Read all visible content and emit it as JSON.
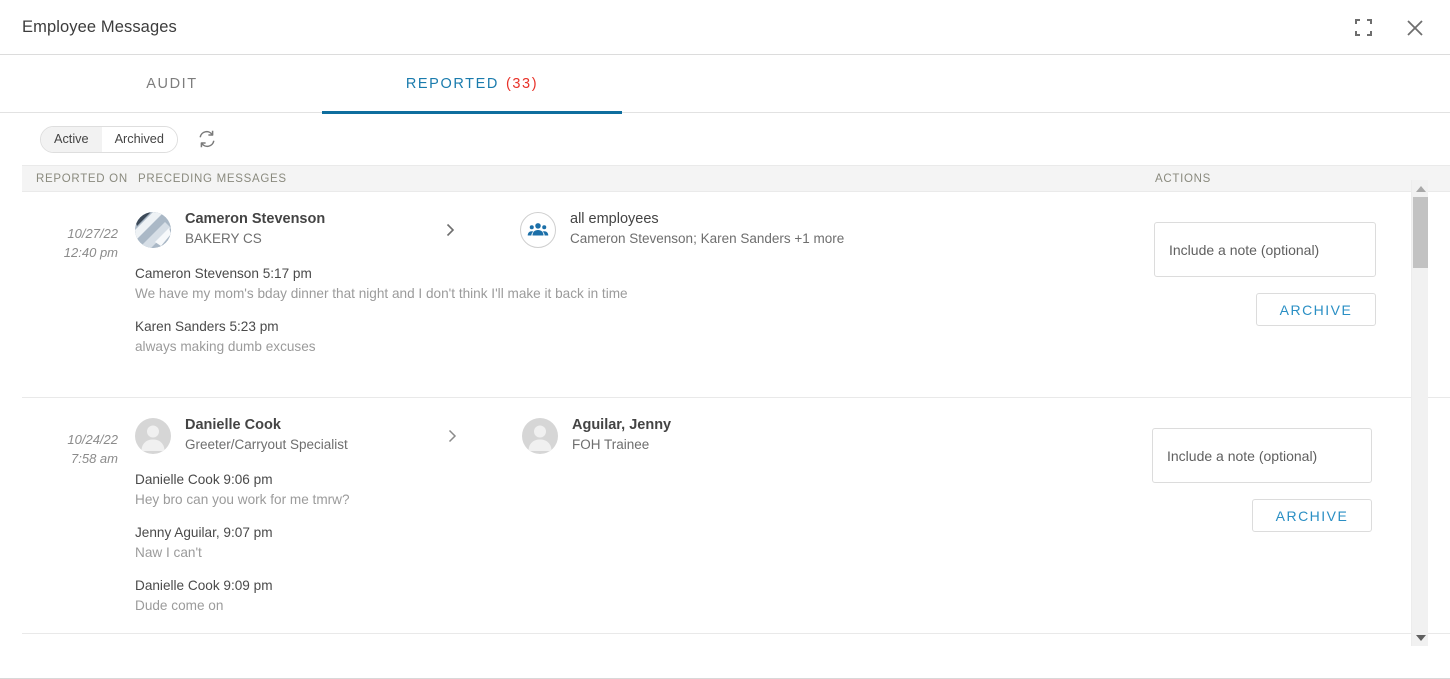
{
  "window": {
    "title": "Employee Messages",
    "controls": [
      {
        "name": "expand-icon",
        "label": "Expand"
      },
      {
        "name": "close-icon",
        "label": "Close"
      }
    ]
  },
  "tabs": [
    {
      "label": "AUDIT",
      "count": "",
      "active": false
    },
    {
      "label": "REPORTED",
      "count": "(33)",
      "active": true
    }
  ],
  "filters": {
    "segments": [
      {
        "label": "Active",
        "selected": true
      },
      {
        "label": "Archived",
        "selected": false
      }
    ],
    "refresh_icon": "refresh-icon"
  },
  "grid": {
    "headers": {
      "reported_on": "REPORTED ON",
      "preceding_messages": "PRECEDING MESSAGES",
      "actions": "ACTIONS"
    }
  },
  "rows": [
    {
      "date": "10/27/22",
      "time": "12:40 pm",
      "sender": {
        "name": "Cameron Stevenson",
        "role": "BAKERY CS",
        "avatar": "photo-avatar"
      },
      "recipient": {
        "name": "all employees",
        "role": "Cameron Stevenson; Karen Sanders +1 more",
        "avatar": "group-icon"
      },
      "messages": [
        {
          "who": "Cameron Stevenson 5:17 pm",
          "text": "We have my mom's bday dinner that night and I don't think I'll make it back in time"
        },
        {
          "who": "Karen Sanders 5:23 pm",
          "text": "always making dumb excuses"
        }
      ],
      "note_placeholder": "Include a note (optional)",
      "archive_label": "ARCHIVE"
    },
    {
      "date": "10/24/22",
      "time": "7:58 am",
      "sender": {
        "name": "Danielle Cook",
        "role": "Greeter/Carryout Specialist",
        "avatar": "person-avatar"
      },
      "recipient": {
        "name": "Aguilar, Jenny",
        "role": "FOH Trainee",
        "avatar": "person-avatar"
      },
      "messages": [
        {
          "who": "Danielle Cook 9:06 pm",
          "text": "Hey bro can you work for me tmrw?"
        },
        {
          "who": "Jenny Aguilar, 9:07 pm",
          "text": "Naw I can't"
        },
        {
          "who": "Danielle Cook 9:09 pm",
          "text": "Dude come on"
        }
      ],
      "note_placeholder": "Include a note (optional)",
      "archive_label": "ARCHIVE"
    }
  ],
  "colors": {
    "tab_active": "#1a7bad",
    "tab_underline": "#0f6e9e",
    "count_red": "#e8332a",
    "archive_blue": "#2a8fc4",
    "group_icon_blue": "#1b6fa8"
  }
}
